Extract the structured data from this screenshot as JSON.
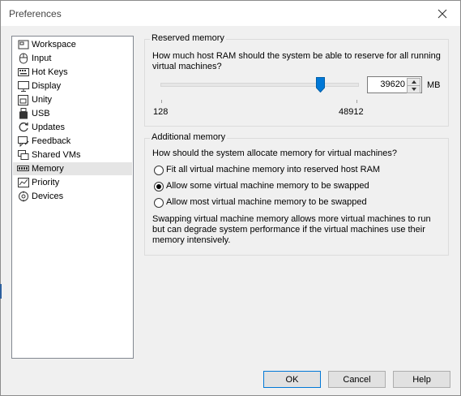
{
  "window": {
    "title": "Preferences"
  },
  "nav": {
    "items": [
      {
        "label": "Workspace",
        "icon": "workspace-icon"
      },
      {
        "label": "Input",
        "icon": "mouse-icon"
      },
      {
        "label": "Hot Keys",
        "icon": "keyboard-icon"
      },
      {
        "label": "Display",
        "icon": "monitor-icon"
      },
      {
        "label": "Unity",
        "icon": "unity-icon"
      },
      {
        "label": "USB",
        "icon": "usb-icon"
      },
      {
        "label": "Updates",
        "icon": "refresh-icon"
      },
      {
        "label": "Feedback",
        "icon": "feedback-icon"
      },
      {
        "label": "Shared VMs",
        "icon": "shared-vms-icon"
      },
      {
        "label": "Memory",
        "icon": "memory-icon"
      },
      {
        "label": "Priority",
        "icon": "priority-icon"
      },
      {
        "label": "Devices",
        "icon": "devices-icon"
      }
    ],
    "selected": "Memory"
  },
  "reserved": {
    "title": "Reserved memory",
    "question_line1": "How much host RAM should the system be able to reserve for all running",
    "question_line2": "virtual machines?",
    "min_label": "128",
    "max_label": "48912",
    "value": "39620",
    "unit": "MB",
    "slider_fraction": 0.81
  },
  "additional": {
    "title": "Additional memory",
    "question": "How should the system allocate memory for virtual machines?",
    "options": [
      {
        "label": "Fit all virtual machine memory into reserved host RAM",
        "selected": false
      },
      {
        "label": "Allow some virtual machine memory to be swapped",
        "selected": true
      },
      {
        "label": "Allow most virtual machine memory to be swapped",
        "selected": false
      }
    ],
    "note_line1": "Swapping virtual machine memory allows more virtual machines to run",
    "note_line2": "but can degrade system performance if the virtual machines use their",
    "note_line3": "memory intensively."
  },
  "buttons": {
    "ok": "OK",
    "cancel": "Cancel",
    "help": "Help"
  },
  "colors": {
    "accent": "#0078d7",
    "selected_bg": "#e5e5e5",
    "window_bg": "#f0f0f0"
  }
}
